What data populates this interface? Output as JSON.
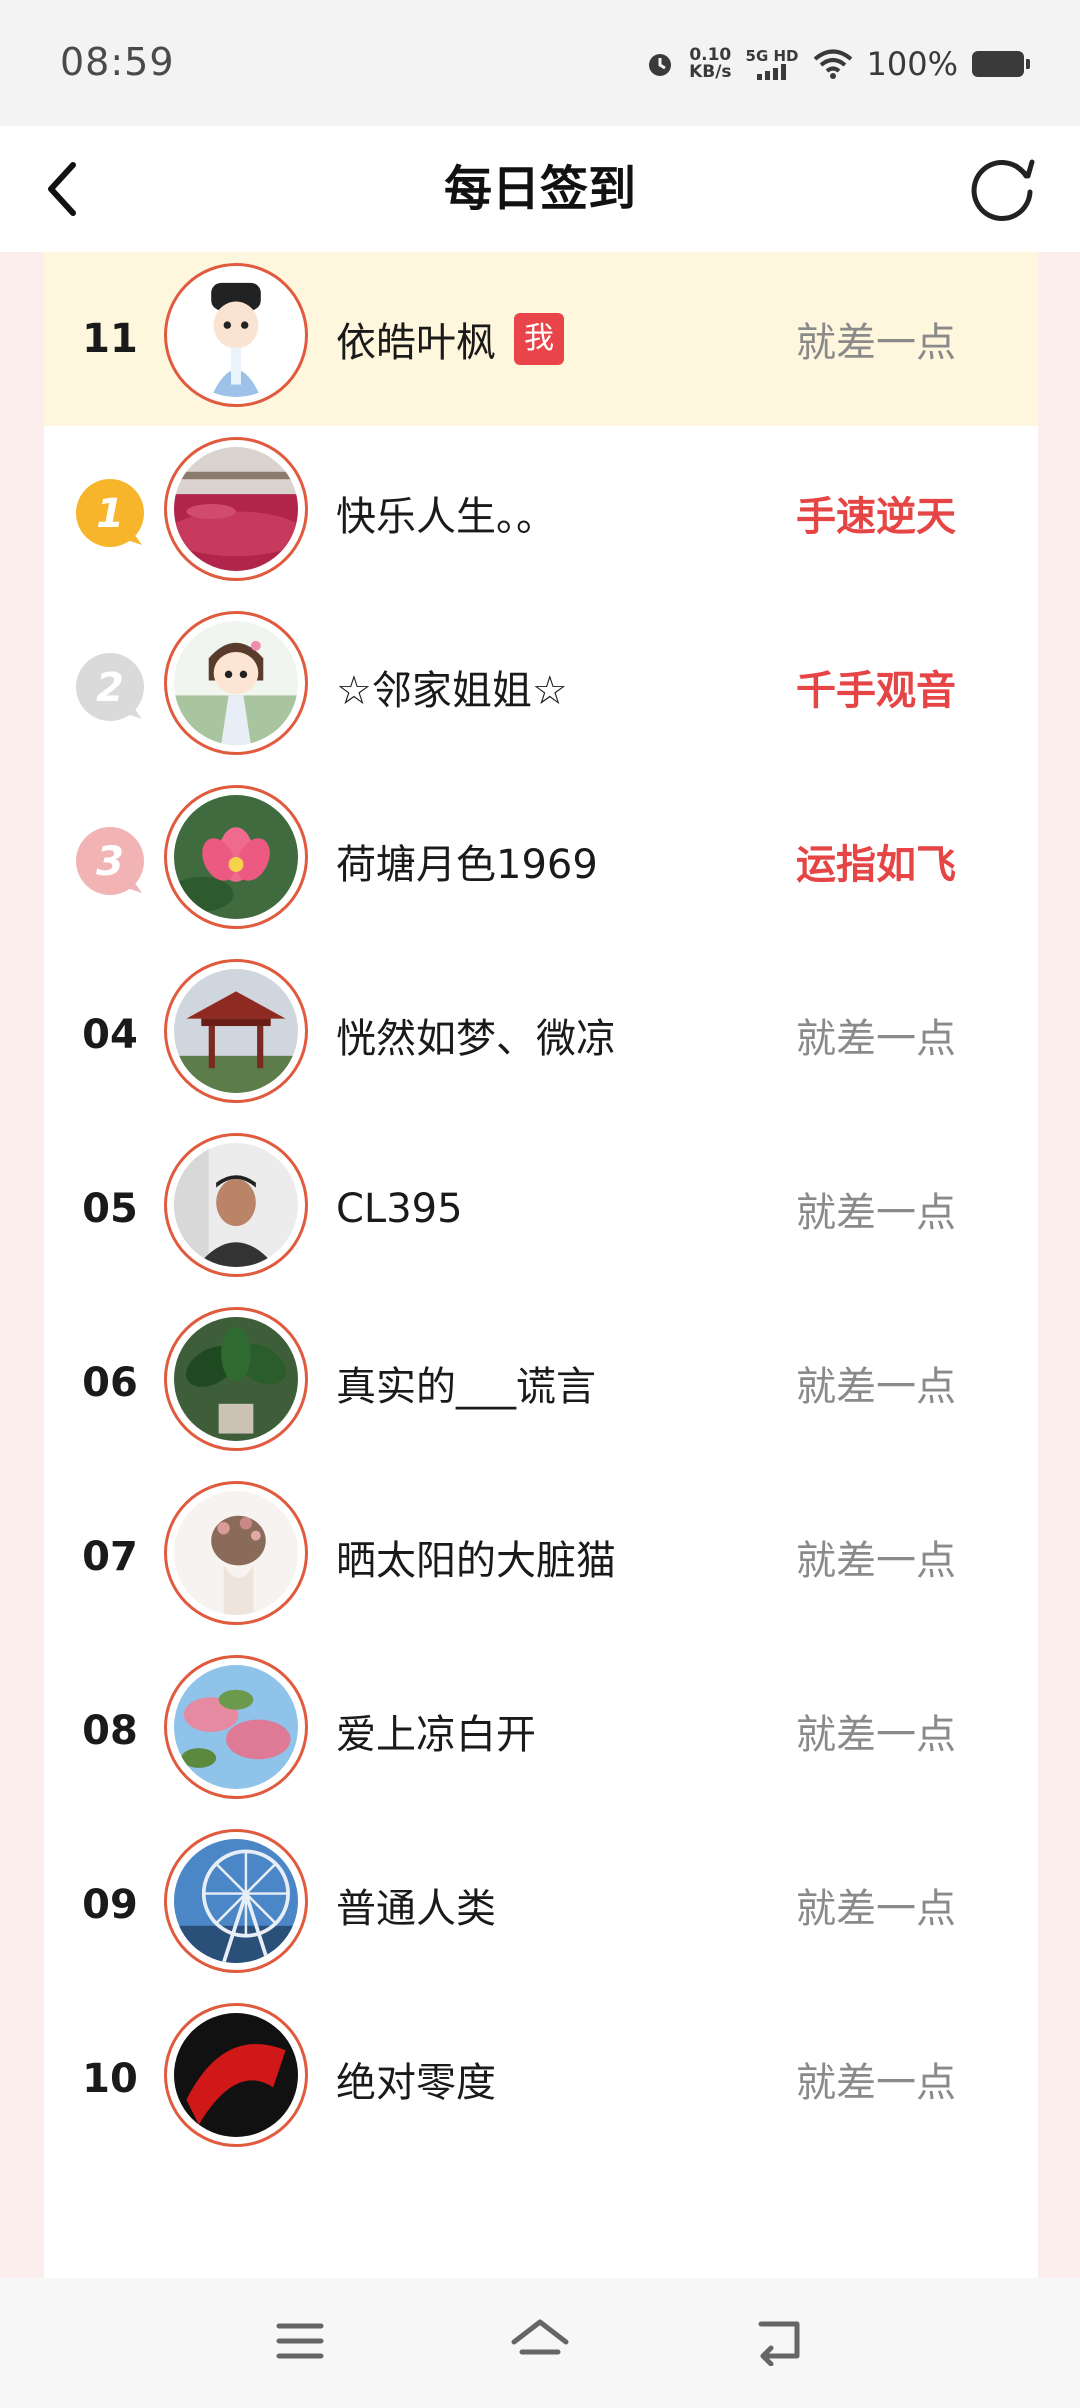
{
  "status_bar": {
    "time": "08:59",
    "net_speed_value": "0.10",
    "net_speed_unit": "KB/s",
    "signal_label": "5G HD",
    "battery": "100%",
    "icons": [
      "alarm-icon",
      "signal-icon",
      "wifi-icon",
      "battery-icon"
    ]
  },
  "header": {
    "title": "每日签到",
    "back_icon": "chevron-left-icon",
    "refresh_icon": "refresh-icon"
  },
  "me_row": {
    "rank": "11",
    "name": "依皓叶枫",
    "badge": "我",
    "status": "就差一点"
  },
  "rows": [
    {
      "rank": "1",
      "medal": "gold",
      "name": "快乐人生。。",
      "status": "手速逆天",
      "hot": true
    },
    {
      "rank": "2",
      "medal": "silver",
      "name": "☆邻家姐姐☆",
      "status": "千手观音",
      "hot": true
    },
    {
      "rank": "3",
      "medal": "bronze",
      "name": "荷塘月色1969",
      "status": "运指如飞",
      "hot": true
    },
    {
      "rank": "04",
      "name": "恍然如梦、微凉",
      "status": "就差一点",
      "hot": false
    },
    {
      "rank": "05",
      "name": "CL395",
      "status": "就差一点",
      "hot": false
    },
    {
      "rank": "06",
      "name": "真实的___谎言",
      "status": "就差一点",
      "hot": false
    },
    {
      "rank": "07",
      "name": "晒太阳的大脏猫",
      "status": "就差一点",
      "hot": false
    },
    {
      "rank": "08",
      "name": "爱上凉白开",
      "status": "就差一点",
      "hot": false
    },
    {
      "rank": "09",
      "name": "普通人类",
      "status": "就差一点",
      "hot": false
    },
    {
      "rank": "10",
      "name": "绝对零度",
      "status": "就差一点",
      "hot": false
    }
  ],
  "colors": {
    "accent_red": "#e64545",
    "me_row_bg": "#fff6de",
    "page_bg": "#fdeeee",
    "avatar_ring": "#e05a3e",
    "muted_text": "#8a8a8a"
  },
  "nav_bar": {
    "icons": [
      "menu-icon",
      "home-icon",
      "back-icon"
    ]
  }
}
